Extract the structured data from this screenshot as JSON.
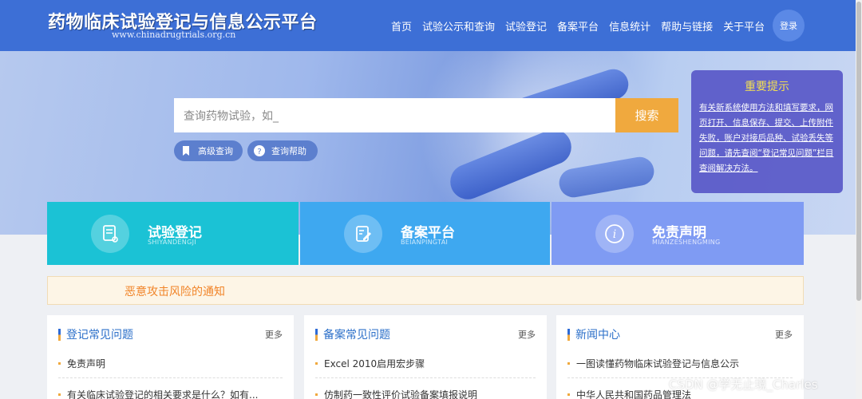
{
  "header": {
    "title": "药物临床试验登记与信息公示平台",
    "url": "www.chinadrugtrials.org.cn",
    "nav": [
      "首页",
      "试验公示和查询",
      "试验登记",
      "备案平台",
      "信息统计",
      "帮助与链接",
      "关于平台"
    ],
    "login_label": "登录"
  },
  "search": {
    "placeholder": "查询药物试验，如_",
    "button_label": "搜索",
    "advanced_label": "高级查询",
    "help_label": "查询帮助"
  },
  "notice": {
    "title": "重要提示",
    "body": "有关新系统使用方法和填写要求，网页打开、信息保存、提交、上传附件失败，账户对接后品种、试验丢失等问题，请先查阅“登记常见问题”栏目查阅解决方法。"
  },
  "tiles": [
    {
      "title": "试验登记",
      "subtitle": "SHIYANDENGJI",
      "icon": "document-icon"
    },
    {
      "title": "备案平台",
      "subtitle": "BEIANPINGTAI",
      "icon": "edit-document-icon"
    },
    {
      "title": "免责声明",
      "subtitle": "MIANZESHENGMING",
      "icon": "info-icon"
    }
  ],
  "alert": {
    "text": "恶意攻击风险的通知"
  },
  "cards": [
    {
      "title": "登记常见问题",
      "more": "更多",
      "items": [
        "免责声明",
        "有关临床试验登记的相关要求是什么？如有..."
      ]
    },
    {
      "title": "备案常见问题",
      "more": "更多",
      "items": [
        "Excel 2010启用宏步骤",
        "仿制药一致性评价试验备案填报说明"
      ]
    },
    {
      "title": "新闻中心",
      "more": "更多",
      "items": [
        "一图读懂药物临床试验登记与信息公示",
        "中华人民共和国药品管理法"
      ]
    }
  ],
  "watermark": "CSDN @学无止境_Charles",
  "colors": {
    "header": "#3d6fd6",
    "search_button": "#f0a93e",
    "notice_bg": "#5c5cc9",
    "notice_title": "#f5e04b",
    "tile1": "#1bc2d5",
    "tile2": "#3ea8f0",
    "tile3": "#7f9bf3",
    "alert_text": "#f18428",
    "card_title": "#2b6fc9"
  }
}
